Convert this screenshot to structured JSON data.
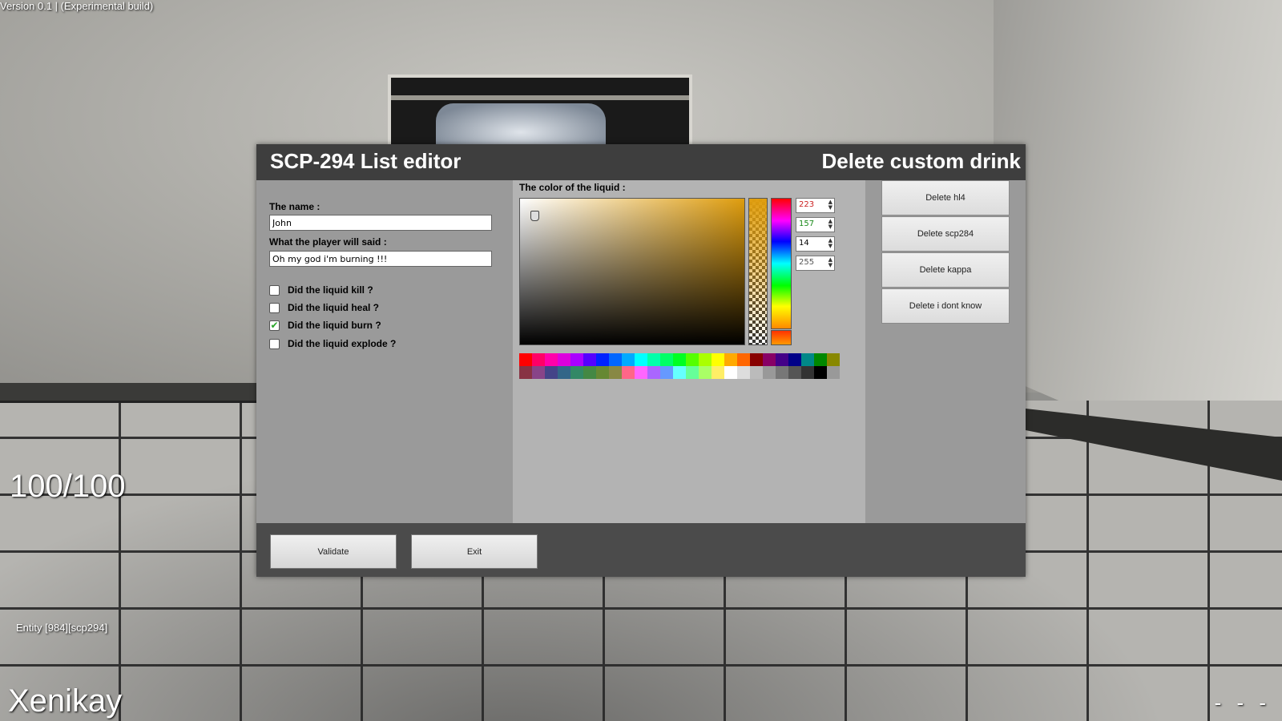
{
  "hud": {
    "version": "Version 0.1 | (Experimental build)",
    "health": "100/100",
    "entity": "Entity [984][scp294]",
    "player": "Xenikay",
    "dashes": "- - -"
  },
  "dialog": {
    "title": "SCP-294 List editor",
    "right_title": "Delete custom drink",
    "form": {
      "name_label": "The name :",
      "name_value": "John",
      "said_label": "What the player will said :",
      "said_value": "Oh my god i'm burning !!!",
      "checkboxes": [
        {
          "label": "Did the liquid kill ?",
          "checked": false
        },
        {
          "label": "Did the liquid heal ?",
          "checked": false
        },
        {
          "label": "Did the liquid burn ?",
          "checked": true
        },
        {
          "label": "Did the liquid explode ?",
          "checked": false
        }
      ]
    },
    "color": {
      "label": "The color of the liquid :",
      "r": "223",
      "g": "157",
      "b": "14",
      "a": "255",
      "hue_color": "#df9d0e",
      "palette": [
        "#ff0000",
        "#ff0066",
        "#ff00aa",
        "#dd00dd",
        "#aa00ff",
        "#5500ff",
        "#0022ff",
        "#0066ff",
        "#00aaff",
        "#00ffff",
        "#00ffaa",
        "#00ff66",
        "#00ff22",
        "#55ff00",
        "#aaff00",
        "#ffff00",
        "#ffaa00",
        "#ff6600",
        "#880000",
        "#880066",
        "#440088",
        "#000088",
        "#008888",
        "#008800",
        "#888800",
        "#883344",
        "#884488",
        "#444488",
        "#336688",
        "#338866",
        "#448844",
        "#668833",
        "#888844",
        "#ff6688",
        "#ff66ff",
        "#aa66ff",
        "#6699ff",
        "#66ffff",
        "#66ff99",
        "#aaff66",
        "#ffee66",
        "#ffffff",
        "#dddddd",
        "#bbbbbb",
        "#999999",
        "#777777",
        "#555555",
        "#333333",
        "#000000",
        "#999999"
      ]
    },
    "delete_buttons": [
      "Delete hl4",
      "Delete scp284",
      "Delete kappa",
      "Delete i dont know"
    ],
    "footer": {
      "validate": "Validate",
      "exit": "Exit"
    }
  }
}
